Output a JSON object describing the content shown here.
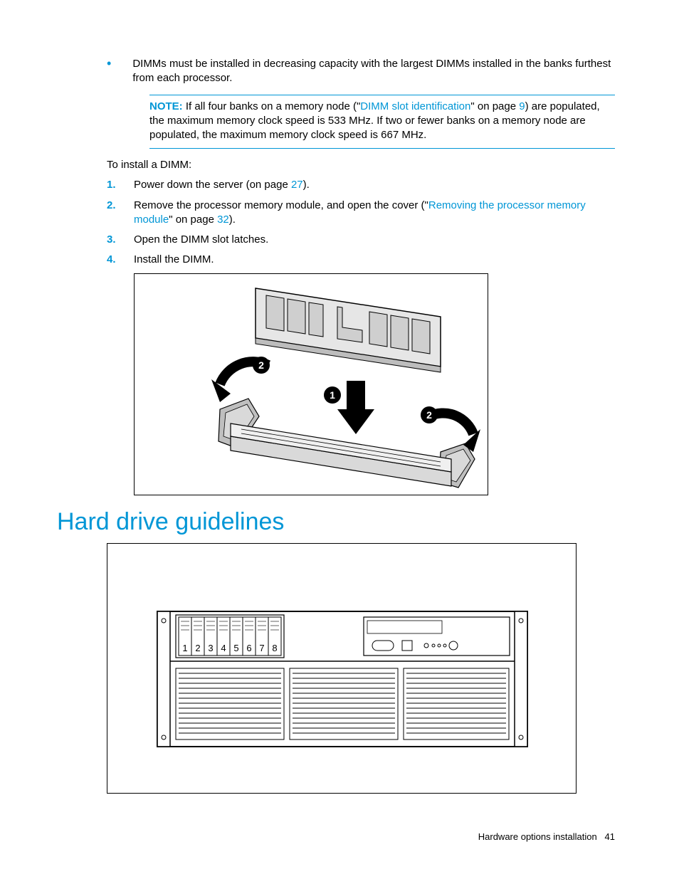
{
  "bullet": {
    "text": "DIMMs must be installed in decreasing capacity with the largest DIMMs installed in the banks furthest from each processor."
  },
  "note": {
    "label": "NOTE:",
    "pre": "If all four banks on a memory node (\"",
    "link1": "DIMM slot identification",
    "mid1": "\" on page ",
    "page1": "9",
    "post": ") are populated, the maximum memory clock speed is 533 MHz. If two or fewer banks on a memory node are populated, the maximum memory clock speed is 667 MHz."
  },
  "preList": "To install a DIMM:",
  "steps": {
    "s1": {
      "num": "1.",
      "pre": "Power down the server (on page ",
      "page": "27",
      "post": ")."
    },
    "s2": {
      "num": "2.",
      "pre": "Remove the processor memory module, and open the cover (\"",
      "link": "Removing the processor memory module",
      "mid": "\" on page ",
      "page": "32",
      "post": ")."
    },
    "s3": {
      "num": "3.",
      "text": "Open the DIMM slot latches."
    },
    "s4": {
      "num": "4.",
      "text": "Install the DIMM."
    }
  },
  "figure1": {
    "callout1": "1",
    "callout2a": "2",
    "callout2b": "2"
  },
  "heading": "Hard drive guidelines",
  "figure2": {
    "bayLabels": [
      "1",
      "2",
      "3",
      "4",
      "5",
      "6",
      "7",
      "8"
    ]
  },
  "footer": {
    "section": "Hardware options installation",
    "page": "41"
  }
}
